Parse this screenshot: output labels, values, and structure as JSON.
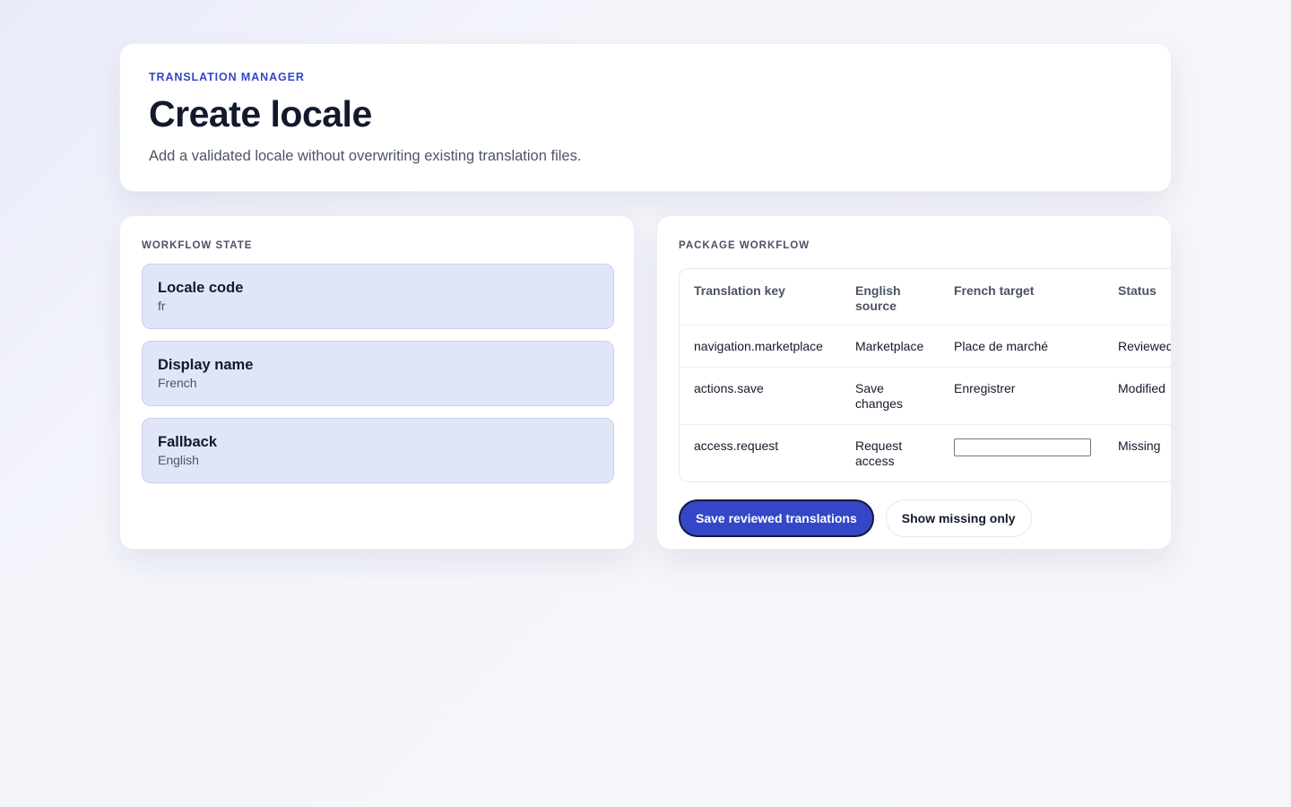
{
  "header": {
    "eyebrow": "TRANSLATION MANAGER",
    "title": "Create locale",
    "subtitle": "Add a validated locale without overwriting existing translation files."
  },
  "workflow_state": {
    "label": "WORKFLOW STATE",
    "items": [
      {
        "title": "Locale code",
        "value": "fr"
      },
      {
        "title": "Display name",
        "value": "French"
      },
      {
        "title": "Fallback",
        "value": "English"
      }
    ]
  },
  "package_workflow": {
    "label": "PACKAGE WORKFLOW",
    "columns": [
      "Translation key",
      "English source",
      "French target",
      "Status"
    ],
    "rows": [
      {
        "key": "navigation.marketplace",
        "source": "Marketplace",
        "target": "Place de marché",
        "status": "Reviewed"
      },
      {
        "key": "actions.save",
        "source": "Save changes",
        "target": "Enregistrer",
        "status": "Modified"
      },
      {
        "key": "access.request",
        "source": "Request access",
        "target": "",
        "status": "Missing"
      }
    ],
    "actions": {
      "save_label": "Save reviewed translations",
      "filter_label": "Show missing only"
    }
  },
  "colors": {
    "accent": "#3447c7",
    "state_card_bg": "#e1e5f8",
    "text_primary": "#121a2c"
  }
}
